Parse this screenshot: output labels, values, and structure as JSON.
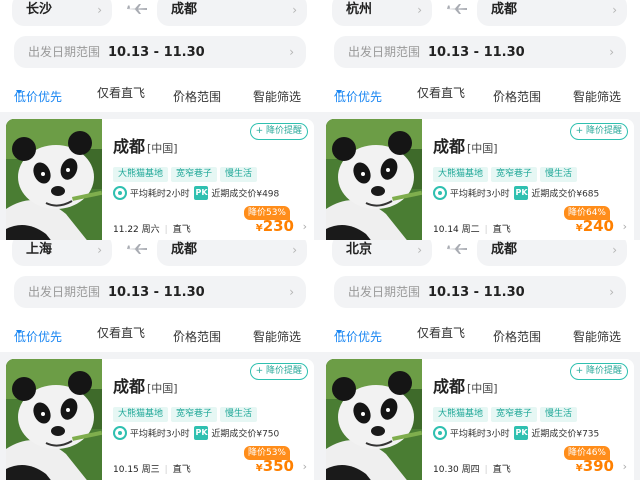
{
  "panels": [
    {
      "from_city": "长沙",
      "to_city": "成都",
      "date_label": "出发日期范围",
      "date_range": "10.13 - 11.30",
      "filters": {
        "low_price": "低价优先",
        "direct_only": "仅看直飞",
        "price_range": "价格范围",
        "smart_filter": "智能筛选"
      },
      "card": {
        "destination": "成都",
        "country": "[中国]",
        "alert_button": "+ 降价提醒",
        "tags": [
          "大熊猫基地",
          "宽窄巷子",
          "慢生活"
        ],
        "avg_time": "平均耗时2小时",
        "pk_label": "PK",
        "recent_price": "近期成交价¥498",
        "date": "11.22 周六",
        "flight_type": "直飞",
        "discount": "降价53%",
        "currency": "¥",
        "price": "230"
      }
    },
    {
      "from_city": "杭州",
      "to_city": "成都",
      "date_label": "出发日期范围",
      "date_range": "10.13 - 11.30",
      "filters": {
        "low_price": "低价优先",
        "direct_only": "仅看直飞",
        "price_range": "价格范围",
        "smart_filter": "智能筛选"
      },
      "card": {
        "destination": "成都",
        "country": "[中国]",
        "alert_button": "+ 降价提醒",
        "tags": [
          "大熊猫基地",
          "宽窄巷子",
          "慢生活"
        ],
        "avg_time": "平均耗时3小时",
        "pk_label": "PK",
        "recent_price": "近期成交价¥685",
        "date": "10.14 周二",
        "flight_type": "直飞",
        "discount": "降价64%",
        "currency": "¥",
        "price": "240"
      }
    },
    {
      "from_city": "上海",
      "to_city": "成都",
      "date_label": "出发日期范围",
      "date_range": "10.13 - 11.30",
      "filters": {
        "low_price": "低价优先",
        "direct_only": "仅看直飞",
        "price_range": "价格范围",
        "smart_filter": "智能筛选"
      },
      "card": {
        "destination": "成都",
        "country": "[中国]",
        "alert_button": "+ 降价提醒",
        "tags": [
          "大熊猫基地",
          "宽窄巷子",
          "慢生活"
        ],
        "avg_time": "平均耗时3小时",
        "pk_label": "PK",
        "recent_price": "近期成交价¥750",
        "date": "10.15 周三",
        "flight_type": "直飞",
        "discount": "降价53%",
        "currency": "¥",
        "price": "350"
      }
    },
    {
      "from_city": "北京",
      "to_city": "成都",
      "date_label": "出发日期范围",
      "date_range": "10.13 - 11.30",
      "filters": {
        "low_price": "低价优先",
        "direct_only": "仅看直飞",
        "price_range": "价格范围",
        "smart_filter": "智能筛选"
      },
      "card": {
        "destination": "成都",
        "country": "[中国]",
        "alert_button": "+ 降价提醒",
        "tags": [
          "大熊猫基地",
          "宽窄巷子",
          "慢生活"
        ],
        "avg_time": "平均耗时3小时",
        "pk_label": "PK",
        "recent_price": "近期成交价¥735",
        "date": "10.30 周四",
        "flight_type": "直飞",
        "discount": "降价46%",
        "currency": "¥",
        "price": "390"
      }
    }
  ],
  "colors": {
    "accent_blue": "#1a86f2",
    "teal": "#2fc0b0",
    "price_orange": "#ff8000",
    "discount_bg": "#ff8d1a",
    "panel_bg": "#f2f3f5"
  },
  "icons": [
    "chevron-right-icon",
    "plane-icon",
    "dropdown-triangle-icon",
    "clock-circle-icon",
    "pk-icon",
    "panda-photo"
  ]
}
